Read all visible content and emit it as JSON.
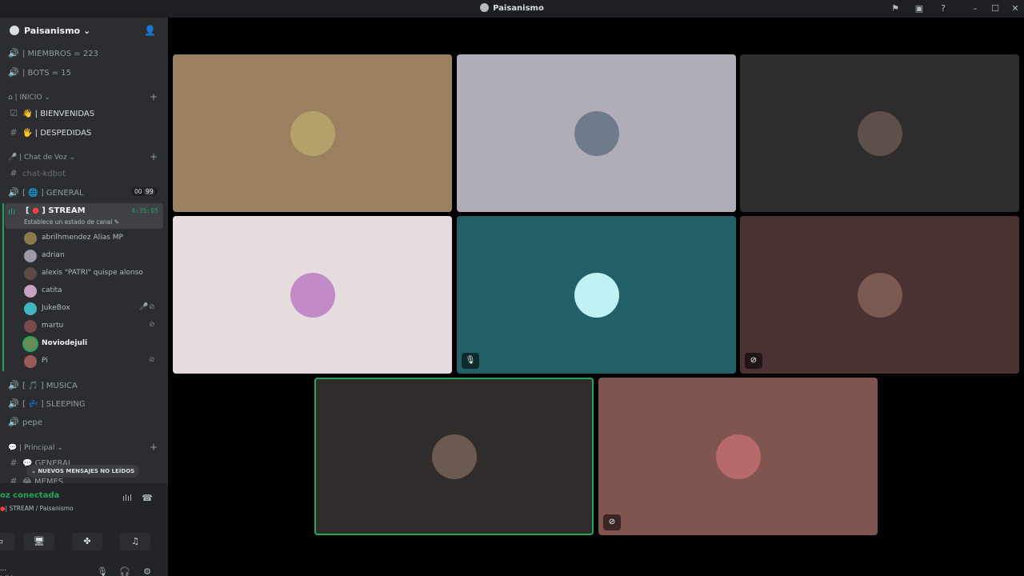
{
  "window": {
    "title": "Paisanismo"
  },
  "server": {
    "name": "Paisanismo"
  },
  "stats": {
    "members": "| MIEMBROS = 223",
    "bots": "| BOTS = 15"
  },
  "categories": {
    "inicio": "| INICIO",
    "voz": "| Chat de Voz",
    "principal": "| Principal"
  },
  "channels": {
    "bienvenidas": "| BIENVENIDAS",
    "despedidas": "| DESPEDIDAS",
    "chat_kdbot": "chat-kdbot",
    "general_voice": "] GENERAL",
    "general_badge_a": "00",
    "general_badge_b": "99",
    "stream": "] STREAM",
    "stream_status": "Establece un estado de canal",
    "stream_timer": "4:35:05",
    "musica": "] MUSICA",
    "sleeping": "] SLEEPING",
    "pepe": "pepe",
    "general_text": "GENERAL",
    "memes": "MEMES"
  },
  "members": [
    {
      "name": "abrilhmendez Alias MP",
      "color": "#8a7a4a"
    },
    {
      "name": "adrian",
      "color": "#9a9aa8"
    },
    {
      "name": "alexis \"PATRI\" quispe alonso",
      "color": "#5a4a42"
    },
    {
      "name": "catita",
      "color": "#c7a2c2"
    },
    {
      "name": "JukeBox",
      "color": "#3fb6c2"
    },
    {
      "name": "martu",
      "color": "#7a4a4a"
    },
    {
      "name": "Noviodejuli",
      "color": "#6a8a5a"
    },
    {
      "name": "Pi",
      "color": "#9a5a5a"
    }
  ],
  "unread": "NUEVOS MENSAJES NO LEÍDOS",
  "voice": {
    "status": "oz conectada",
    "location": "| STREAM / Paisanismo"
  },
  "user": {
    "name": "...",
    "status": "isible"
  },
  "tiles": [
    {
      "bg": "#9a805f",
      "avatar": "#b3a06a",
      "muted": false,
      "speaking": false
    },
    {
      "bg": "#b0acb8",
      "avatar": "#6f7a8a",
      "muted": false,
      "speaking": false
    },
    {
      "bg": "#2e2c2c",
      "avatar": "#5d4f4a",
      "muted": false,
      "speaking": false
    },
    {
      "bg": "#e6dcdd",
      "avatar": "#c28ac9",
      "muted": false,
      "speaking": false
    },
    {
      "bg": "#235f67",
      "avatar": "#bff1f5",
      "muted": true,
      "speaking": false
    },
    {
      "bg": "#4a3232",
      "avatar": "#7a5a52",
      "muted": true,
      "speaking": false
    },
    {
      "bg": "#302c2b",
      "avatar": "#6b5a52",
      "muted": false,
      "speaking": true
    },
    {
      "bg": "#805550",
      "avatar": "#b86a6a",
      "muted": true,
      "speaking": false
    }
  ]
}
